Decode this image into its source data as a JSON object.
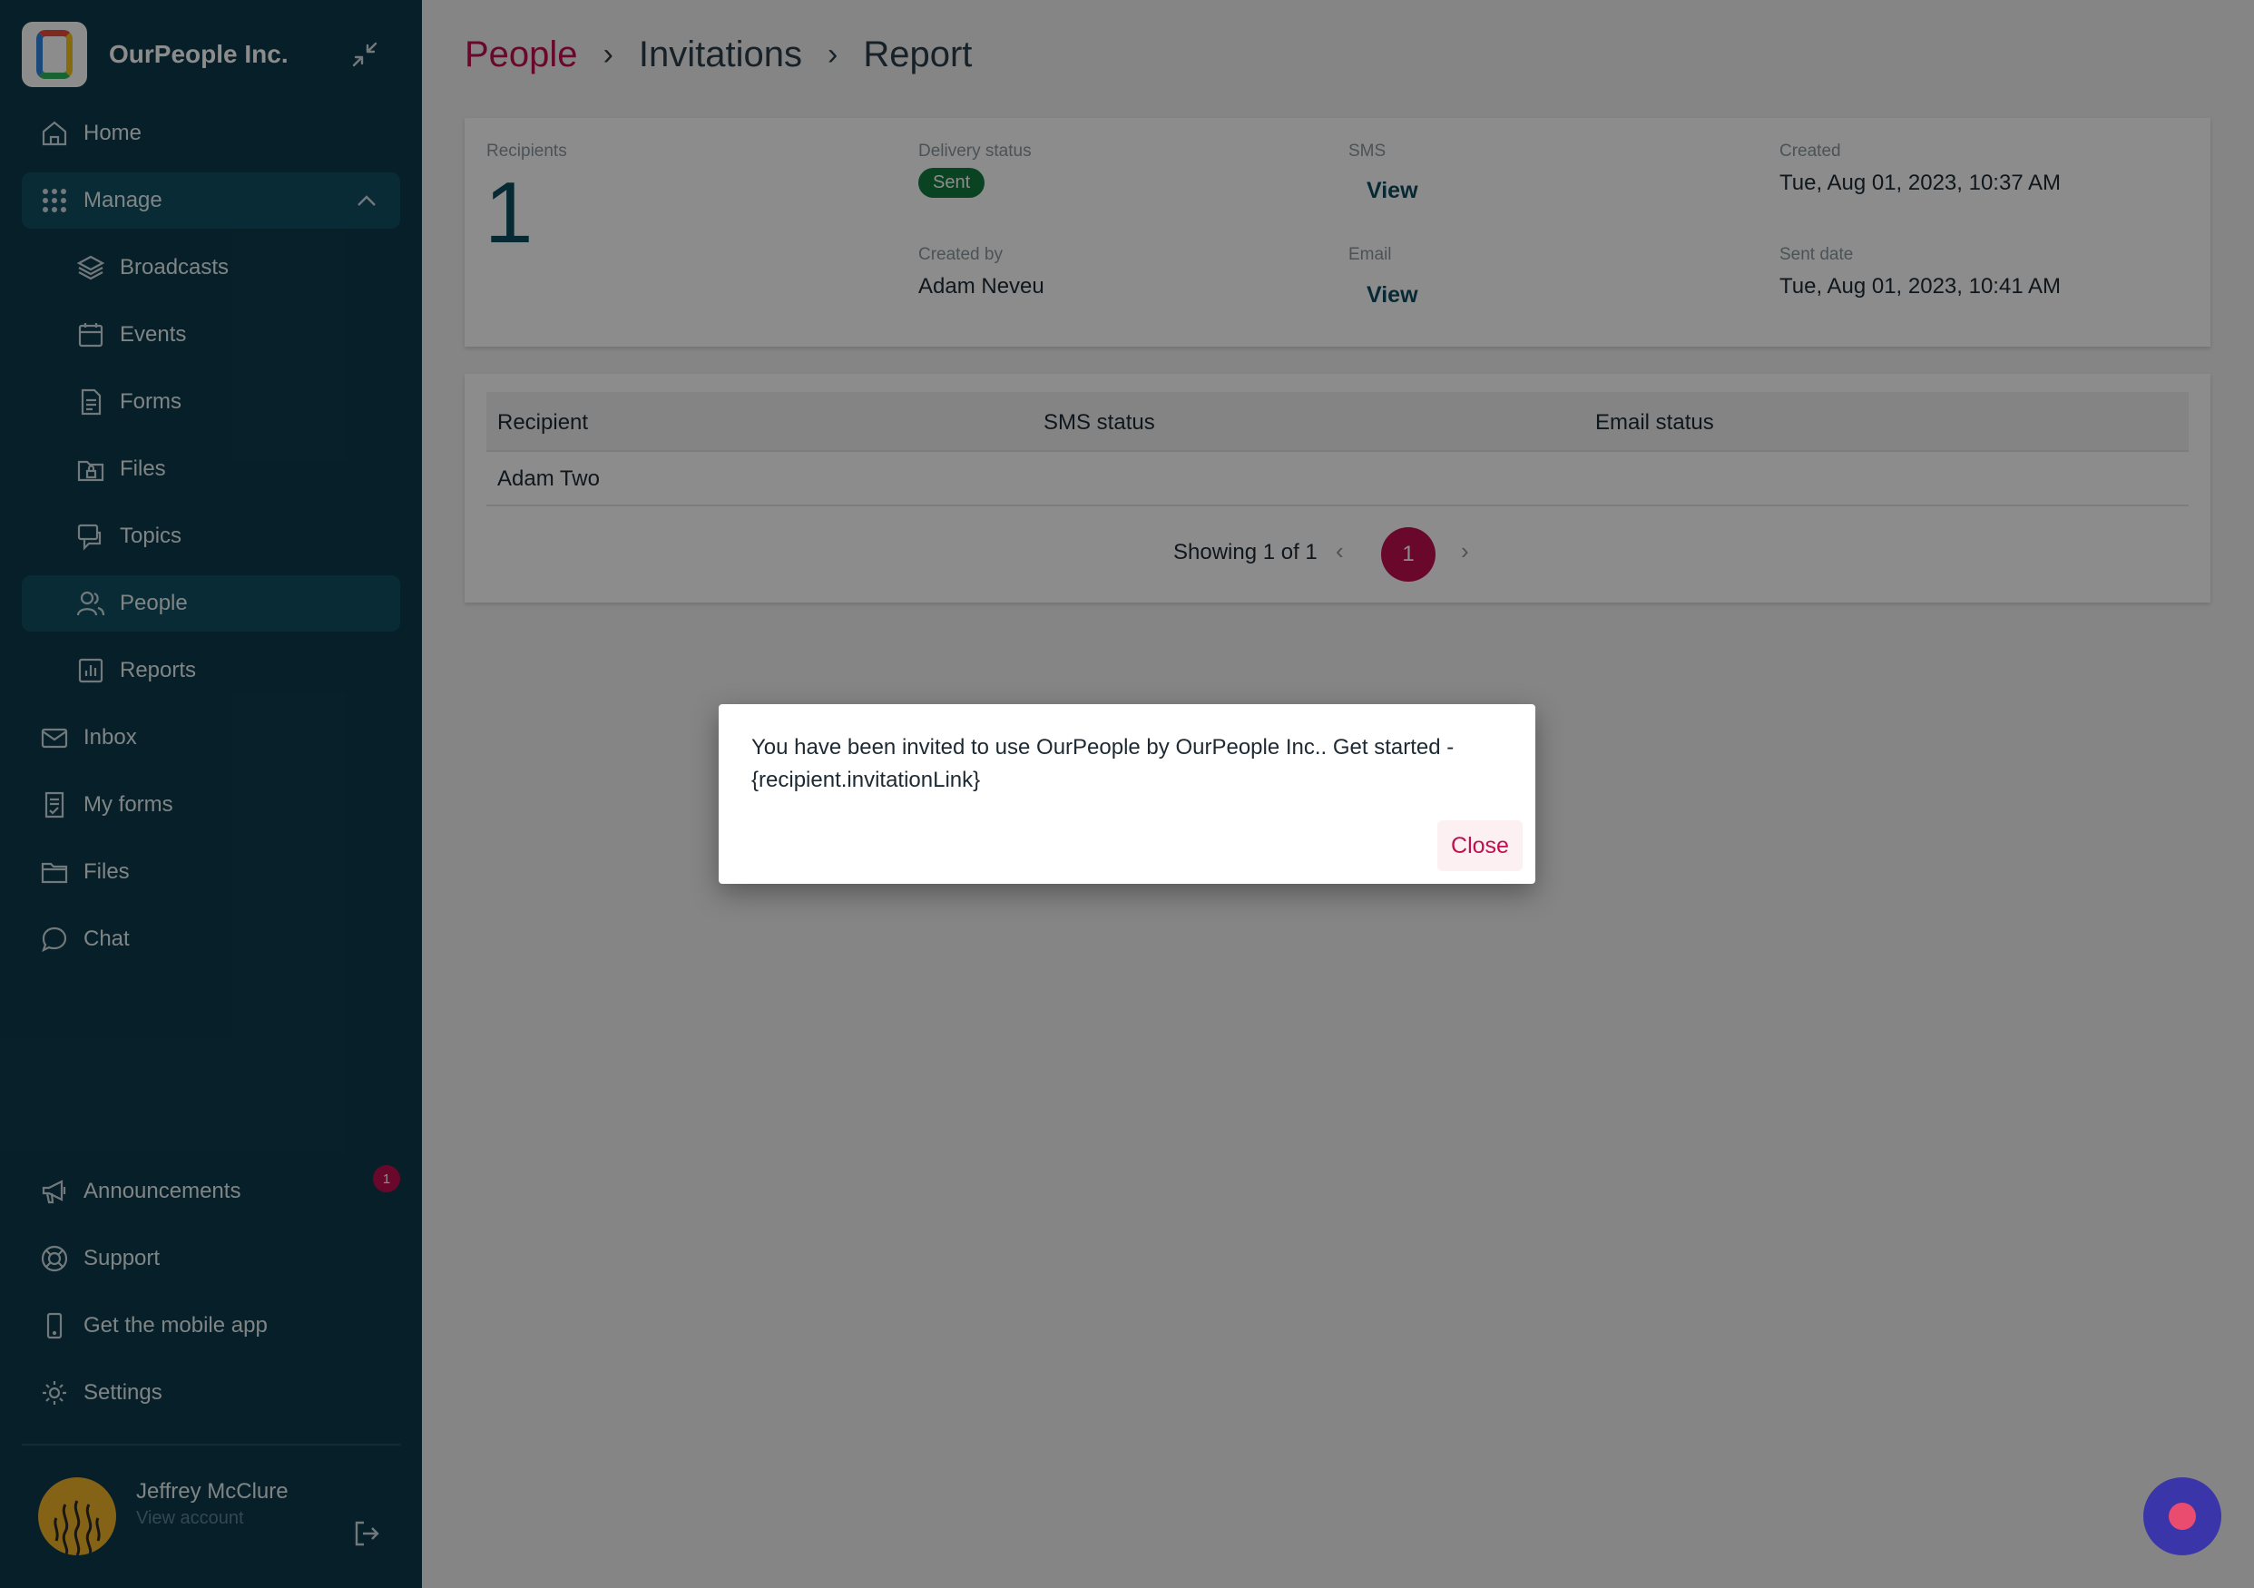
{
  "sidebar": {
    "org_name": "OurPeople Inc.",
    "items": {
      "home": "Home",
      "manage": "Manage",
      "broadcasts": "Broadcasts",
      "events": "Events",
      "forms": "Forms",
      "files_sub": "Files",
      "topics": "Topics",
      "people": "People",
      "reports": "Reports",
      "inbox": "Inbox",
      "my_forms": "My forms",
      "files": "Files",
      "chat": "Chat",
      "announcements": "Announcements",
      "support": "Support",
      "mobile_app": "Get the mobile app",
      "settings": "Settings"
    },
    "announcements_badge": "1",
    "user": {
      "name": "Jeffrey McClure",
      "sub": "View account"
    }
  },
  "breadcrumb": {
    "first": "People",
    "second": "Invitations",
    "third": "Report",
    "sep": "›"
  },
  "summary": {
    "recipients_label": "Recipients",
    "recipients_value": "1",
    "delivery_label": "Delivery status",
    "delivery_value": "Sent",
    "created_by_label": "Created by",
    "created_by_value": "Adam Neveu",
    "sms_label": "SMS",
    "sms_link": "View",
    "email_label": "Email",
    "email_link": "View",
    "created_label": "Created",
    "created_value": "Tue, Aug 01, 2023, 10:37 AM",
    "sent_label": "Sent date",
    "sent_value": "Tue, Aug 01, 2023, 10:41 AM"
  },
  "table": {
    "headers": [
      "Recipient",
      "SMS status",
      "Email status"
    ],
    "rows": [
      {
        "recipient": "Adam Two",
        "sms": "",
        "email": ""
      }
    ],
    "showing": "Showing 1 of 1",
    "page": "1",
    "prev": "‹",
    "next": "›"
  },
  "modal": {
    "text": "You have been invited to use OurPeople by OurPeople Inc.. Get started - {recipient.invitationLink}",
    "close_label": "Close"
  },
  "colors": {
    "sidebar": "#0c3a4a",
    "accent": "#c0104f",
    "success": "#137a3e",
    "fab": "#3a35a8"
  }
}
